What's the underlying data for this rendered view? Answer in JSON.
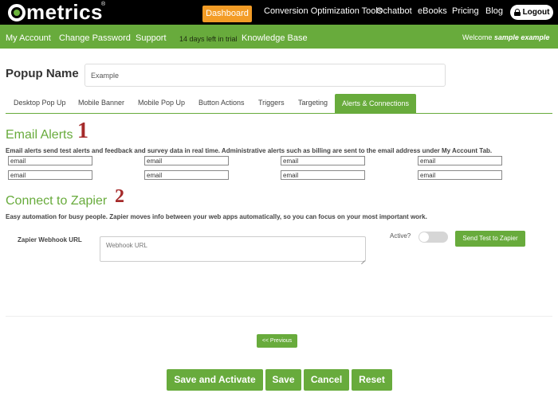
{
  "brand": {
    "logo_text": "metrics",
    "reg_mark": "®"
  },
  "topnav": {
    "dashboard": "Dashboard",
    "items": [
      "Conversion Optimization Tools",
      "Ochatbot",
      "eBooks",
      "Pricing",
      "Blog"
    ],
    "logout": "Logout"
  },
  "subnav": {
    "items": [
      "My Account",
      "Change Password",
      "Support"
    ],
    "trial": "14 days left in trial",
    "knowledge_base": "Knowledge Base",
    "welcome_prefix": "Welcome",
    "welcome_user": "sample example"
  },
  "popup": {
    "label": "Popup Name",
    "value": "Example"
  },
  "tabs": [
    {
      "label": "Desktop Pop Up"
    },
    {
      "label": "Mobile Banner"
    },
    {
      "label": "Mobile Pop Up"
    },
    {
      "label": "Button Actions"
    },
    {
      "label": "Triggers"
    },
    {
      "label": "Targeting"
    },
    {
      "label": "Alerts & Connections",
      "active": true
    }
  ],
  "email_alerts": {
    "title": "Email Alerts",
    "number": "1",
    "description": "Email alerts send test alerts and feedback and survey data in real time. Administrative alerts such as billing are sent to the email address under My Account Tab.",
    "fields": [
      "email",
      "email",
      "email",
      "email",
      "email",
      "email",
      "email",
      "email"
    ]
  },
  "zapier": {
    "title": "Connect to Zapier",
    "number": "2",
    "description": "Easy automation for busy people. Zapier moves info between your web apps automatically, so you can focus on your most important work.",
    "webhook_label": "Zapier Webhook URL",
    "webhook_placeholder": "Webhook URL",
    "active_label": "Active?",
    "active": false,
    "send_test": "Send Test to Zapier"
  },
  "nav_buttons": {
    "previous": "<< Previous"
  },
  "actions": {
    "save_activate": "Save and Activate",
    "save": "Save",
    "cancel": "Cancel",
    "reset": "Reset"
  },
  "colors": {
    "green": "#68ab3c",
    "orange": "#f39c26",
    "number_red": "#a52a2a"
  }
}
